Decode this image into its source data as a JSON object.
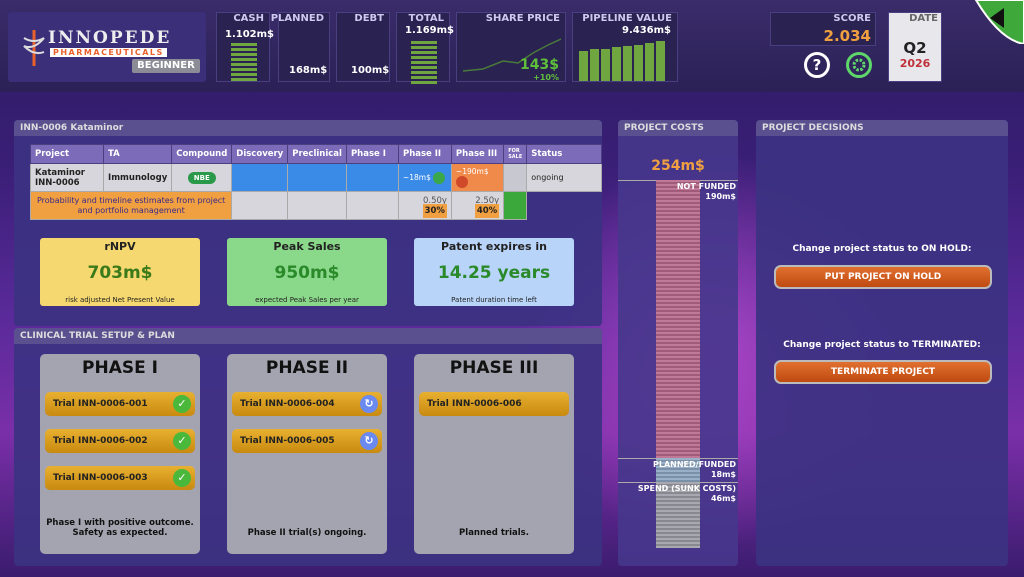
{
  "company": {
    "name_line1": "INNOPEDE",
    "name_line2": "PHARMACEUTICALS",
    "level": "BEGINNER"
  },
  "kpis": {
    "cash": {
      "label": "CASH",
      "value": "1.102m$"
    },
    "planned": {
      "label": "PLANNED",
      "value": "168m$"
    },
    "debt": {
      "label": "DEBT",
      "value": "100m$"
    },
    "total": {
      "label": "TOTAL",
      "value": "1.169m$"
    },
    "share_price": {
      "label": "SHARE PRICE",
      "value": "143$",
      "change": "+10%"
    },
    "pipeline": {
      "label": "PIPELINE VALUE",
      "value": "9.436m$"
    }
  },
  "score": {
    "label": "SCORE",
    "value": "2.034"
  },
  "date": {
    "label": "DATE",
    "quarter": "Q2",
    "year": "2026"
  },
  "help_icon": "?",
  "project": {
    "header": "INN-0006 Kataminor",
    "columns": [
      "Project",
      "TA",
      "Compound",
      "Discovery",
      "Preclinical",
      "Phase I",
      "Phase II",
      "Phase III",
      "FOR SALE",
      "Status"
    ],
    "row": {
      "project": "Kataminor INN-0006",
      "ta": "Immunology",
      "compound": "NBE",
      "phase2_cost": "~18m$",
      "phase3_cost": "~190m$",
      "status": "ongoing"
    },
    "prob_row": {
      "label": "Probability and timeline estimates from project and portfolio management",
      "phase2_time": "0.50y",
      "phase2_prob": "30%",
      "phase3_time": "2.50y",
      "phase3_prob": "40%"
    }
  },
  "metrics": {
    "rnpv": {
      "title": "rNPV",
      "value": "703m$",
      "sub": "risk adjusted Net Present Value"
    },
    "peak": {
      "title": "Peak Sales",
      "value": "950m$",
      "sub": "expected Peak Sales per year"
    },
    "patent": {
      "title": "Patent expires in",
      "value": "14.25 years",
      "sub": "Patent duration time left"
    }
  },
  "trials": {
    "header": "CLINICAL TRIAL SETUP & PLAN",
    "phase1": {
      "title": "PHASE I",
      "items": [
        "Trial INN-0006-001",
        "Trial INN-0006-002",
        "Trial INN-0006-003"
      ],
      "note": "Phase I with positive outcome. Safety as expected."
    },
    "phase2": {
      "title": "PHASE II",
      "items": [
        "Trial INN-0006-004",
        "Trial INN-0006-005"
      ],
      "note": "Phase II trial(s) ongoing."
    },
    "phase3": {
      "title": "PHASE III",
      "items": [
        "Trial INN-0006-006"
      ],
      "note": "Planned trials."
    }
  },
  "costs": {
    "header": "PROJECT COSTS",
    "total": "254m$",
    "not_funded_label": "NOT FUNDED",
    "not_funded": "190m$",
    "planned_label": "PLANNED/FUNDED",
    "planned": "18m$",
    "spend_label": "SPEND (SUNK COSTS)",
    "spend": "46m$"
  },
  "decisions": {
    "header": "PROJECT DECISIONS",
    "hold_label": "Change project status to ON HOLD:",
    "hold_button": "PUT PROJECT ON HOLD",
    "term_label": "Change project status to TERMINATED:",
    "term_button": "TERMINATE PROJECT"
  },
  "colors": {
    "accent": "#e8602a",
    "score": "#f0a040",
    "green": "#6fa640"
  }
}
